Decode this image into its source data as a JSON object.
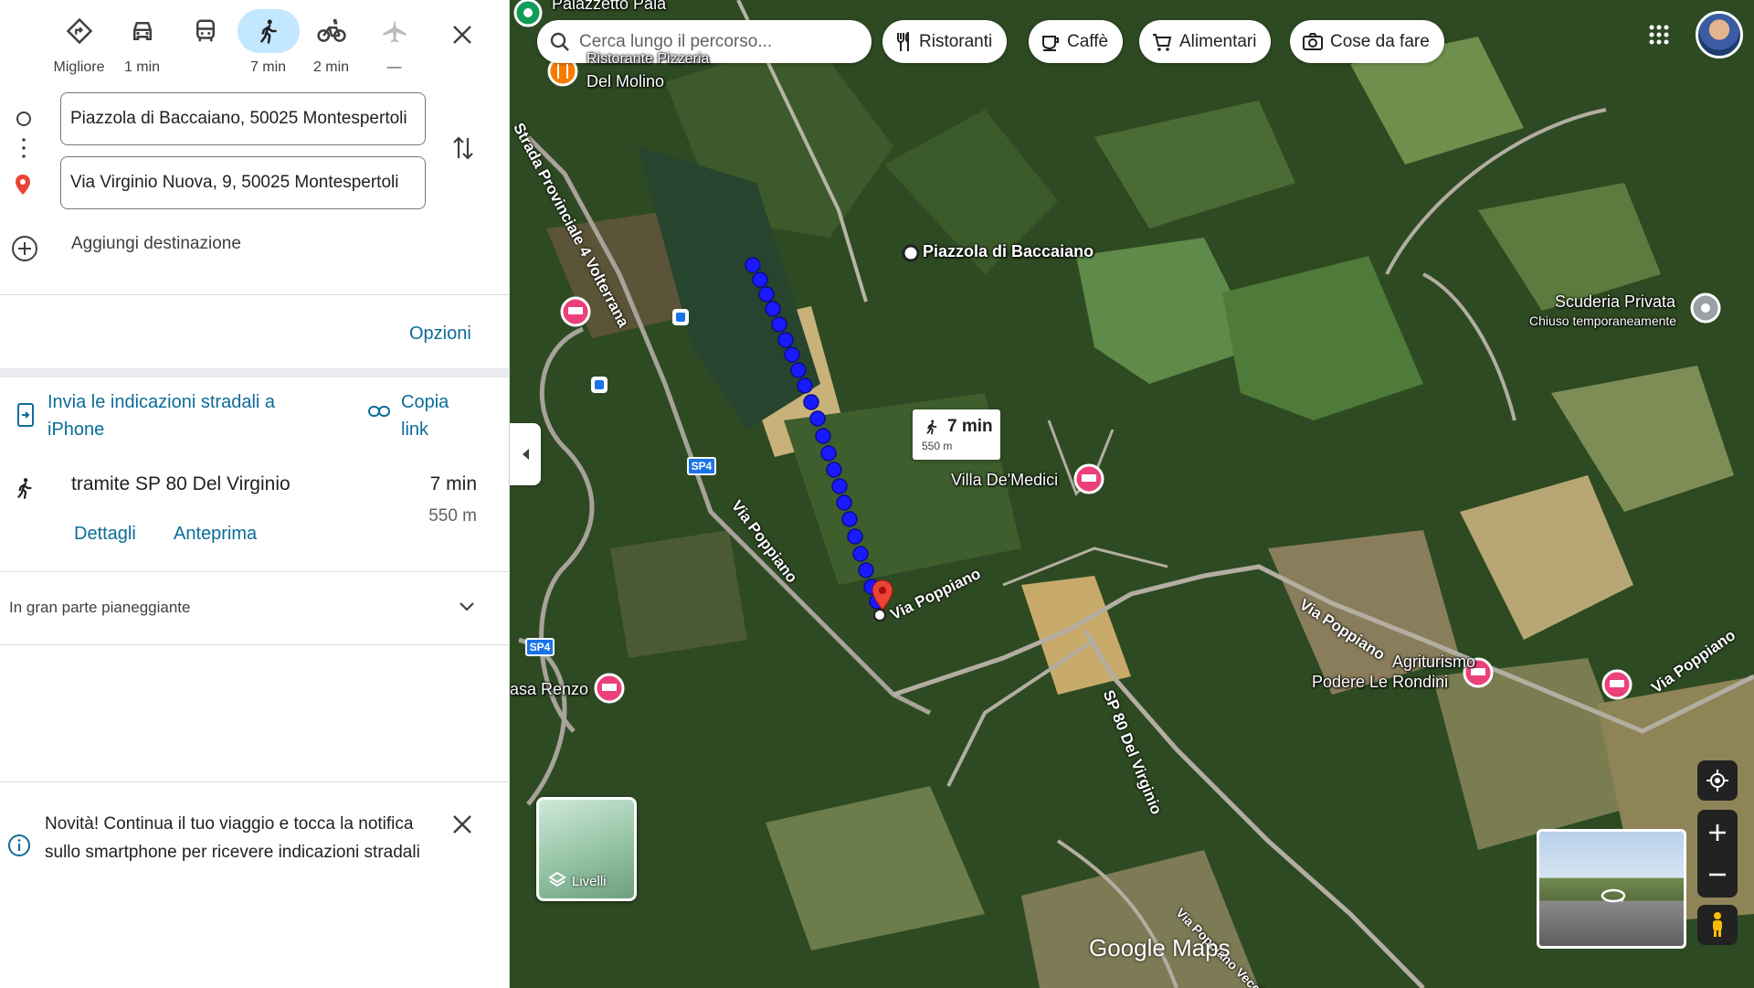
{
  "travel_modes": [
    {
      "icon": "best-route-icon",
      "label": "Migliore"
    },
    {
      "icon": "car-icon",
      "label": "1 min"
    },
    {
      "icon": "transit-icon",
      "label": ""
    },
    {
      "icon": "walking-icon",
      "label": "7 min"
    },
    {
      "icon": "bicycle-icon",
      "label": "2 min"
    },
    {
      "icon": "plane-icon",
      "label": "—"
    }
  ],
  "directions": {
    "origin": "Piazzola di Baccaiano, 50025 Montespertoli",
    "destination": "Via Virginio Nuova, 9, 50025 Montespertoli",
    "add_destination": "Aggiungi destinazione",
    "options_label": "Opzioni",
    "send_to_phone": "Invia le indicazioni stradali a iPhone",
    "copy_link": "Copia link"
  },
  "route": {
    "summary": "tramite SP 80 Del Virginio",
    "time": "7 min",
    "distance": "550 m",
    "details": "Dettagli",
    "preview": "Anteprima",
    "terrain": "In gran parte pianeggiante"
  },
  "notice": {
    "text": "Novità! Continua il tuo viaggio e tocca la notifica sullo smartphone per ricevere indicazioni stradali"
  },
  "map": {
    "search_placeholder": "Cerca lungo il percorso...",
    "chips": [
      {
        "icon": "restaurant-icon",
        "label": "Ristoranti"
      },
      {
        "icon": "coffee-icon",
        "label": "Caffè"
      },
      {
        "icon": "cart-icon",
        "label": "Alimentari"
      },
      {
        "icon": "camera-icon",
        "label": "Cose da fare"
      }
    ],
    "route_card_time": "7 min",
    "route_card_distance": "550 m",
    "labels": {
      "origin": "Piazzola di Baccaiano",
      "villa": "Villa De'Medici",
      "scuderia": "Scuderia Privata",
      "scuderia_status": "Chiuso temporaneamente",
      "agriturismo_1": "Agriturismo",
      "agriturismo_2": "Podere Le Rondini",
      "casa_renzo": "asa Renzo",
      "molino_1": "Ristorante Pizzeria",
      "molino_2": "Del Molino",
      "palazzetto": "Palazzetto Pala",
      "sp4_road": "Strada Provinciale 4 Volterrana",
      "poppiano_1": "Via Poppiano",
      "poppiano_2": "Via Poppiano",
      "poppiano_3": "Via Poppiano",
      "poppiano_4": "Via Poppiano",
      "sp80": "SP 80 Del Virginio",
      "via_bottom": "Via Poppiano Vecchia",
      "sp4_a": "SP4",
      "sp4_b": "SP4",
      "layers": "Livelli",
      "brand": "Google Maps"
    },
    "route_color": "#1a1aff"
  }
}
